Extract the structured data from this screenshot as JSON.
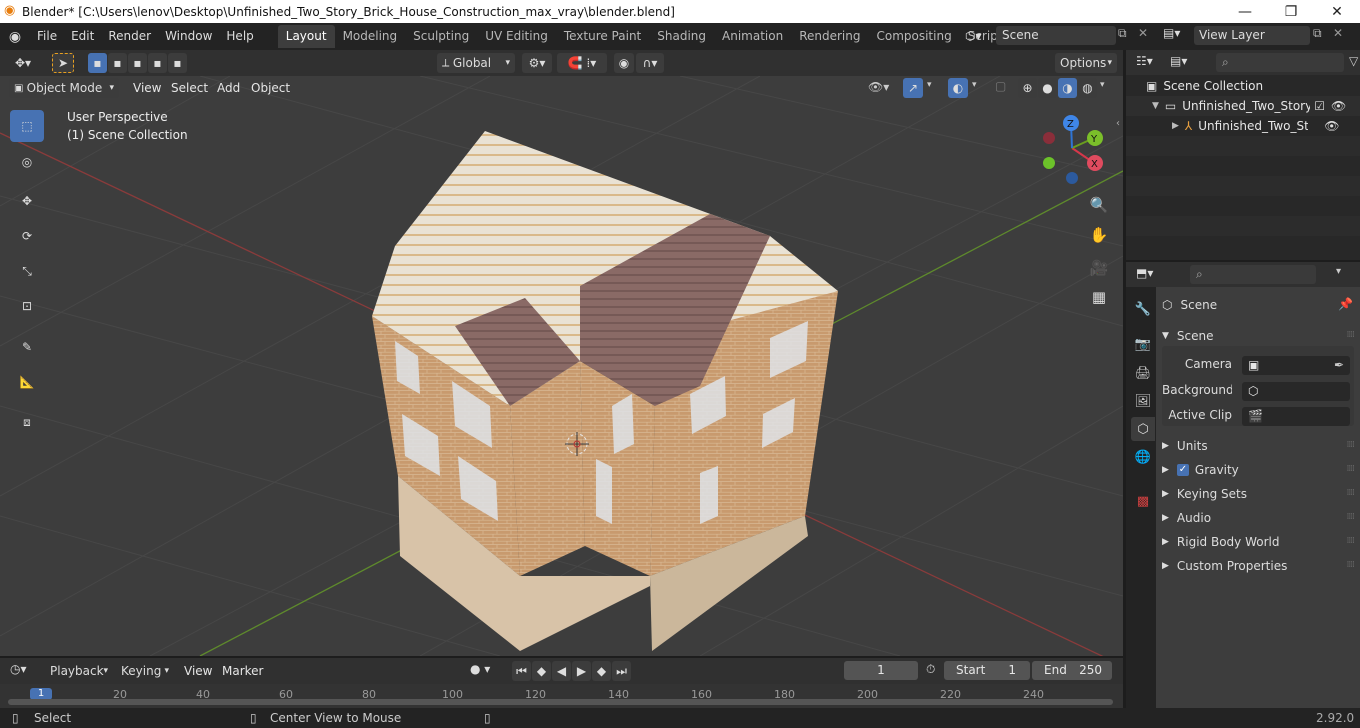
{
  "window": {
    "title": "Blender* [C:\\Users\\lenov\\Desktop\\Unfinished_Two_Story_Brick_House_Construction_max_vray\\blender.blend]",
    "min": "—",
    "max": "❐",
    "close": "✕"
  },
  "menus": [
    "File",
    "Edit",
    "Render",
    "Window",
    "Help"
  ],
  "workspaces": [
    "Layout",
    "Modeling",
    "Sculpting",
    "UV Editing",
    "Texture Paint",
    "Shading",
    "Animation",
    "Rendering",
    "Compositing",
    "Scripting"
  ],
  "scene_field": "Scene",
  "view_layer_field": "View Layer",
  "toolbar": {
    "transform": "Global",
    "options": "Options"
  },
  "viewport_header": {
    "mode": "Object Mode",
    "view": "View",
    "select": "Select",
    "add": "Add",
    "object": "Object"
  },
  "overlay_text": {
    "perspective": "User Perspective",
    "collection": "(1) Scene Collection"
  },
  "gizmo": {
    "x": "X",
    "y": "Y",
    "z": "Z"
  },
  "outliner": {
    "root": "Scene Collection",
    "item1": "Unfinished_Two_Story_Bi",
    "item2": "Unfinished_Two_Stor"
  },
  "properties": {
    "scene_header": "Scene",
    "section_scene": "Scene",
    "camera_label": "Camera",
    "background_label": "Background ...",
    "clip_label": "Active Clip",
    "units": "Units",
    "gravity": "Gravity",
    "keying": "Keying Sets",
    "audio": "Audio",
    "rigid": "Rigid Body World",
    "custom": "Custom Properties"
  },
  "timeline": {
    "playback": "Playback",
    "keying": "Keying",
    "view": "View",
    "marker": "Marker",
    "frame": "1",
    "start_label": "Start",
    "start": "1",
    "end_label": "End",
    "end": "250",
    "ticks": [
      "1",
      "20",
      "40",
      "60",
      "80",
      "100",
      "120",
      "140",
      "160",
      "180",
      "200",
      "220",
      "240"
    ]
  },
  "status": {
    "select": "Select",
    "center": "Center View to Mouse",
    "version": "2.92.0"
  }
}
